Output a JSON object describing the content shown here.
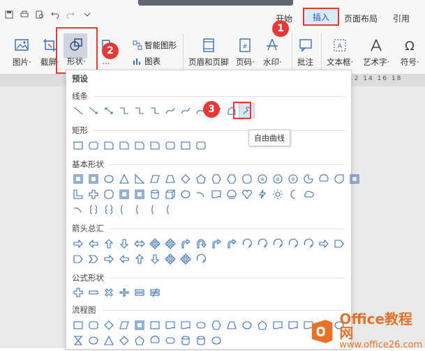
{
  "menu": {
    "start": "开始",
    "insert": "插入",
    "page_layout": "页面布局",
    "reference": "引用"
  },
  "ribbon": {
    "picture": "图片·",
    "screenshot": "截屏·",
    "shape": "形状·",
    "smart_shape": "智能图形",
    "chart": "图表",
    "header_footer": "页眉和页脚",
    "page_number": "页码·",
    "watermark": "水印·",
    "comment": "批注",
    "textbox": "文本框·",
    "art_text": "艺术字·",
    "symbol": "符号·"
  },
  "ruler_text": "12 14 16 18",
  "panel": {
    "preset": "预设",
    "sections": [
      "线条",
      "矩形",
      "基本形状",
      "箭头总汇",
      "公式形状",
      "流程图"
    ]
  },
  "tooltip": "自由曲线",
  "badges": [
    "1",
    "2",
    "3"
  ],
  "watermark": {
    "line1": "Office教程网",
    "line2": "www.office26.com"
  },
  "colors": {
    "accent": "#1f5bc0",
    "highlight_red": "#e53935",
    "shape_stroke": "#3d6fb0"
  }
}
